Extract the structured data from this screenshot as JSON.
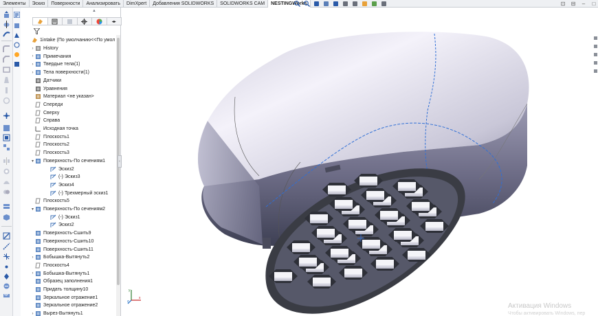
{
  "toolbar_tabs": [
    {
      "label": "Элементы"
    },
    {
      "label": "Эскиз"
    },
    {
      "label": "Поверхности"
    },
    {
      "label": "Анализировать"
    },
    {
      "label": "DimXpert"
    },
    {
      "label": "Добавления SOLIDWORKS"
    },
    {
      "label": "SOLIDWORKS CAM"
    },
    {
      "label": "NESTINGWorks"
    }
  ],
  "active_tab": "NESTINGWorks",
  "view_toolbar_icons": [
    "zoom-to-fit-icon",
    "zoom-area-icon",
    "previous-view-icon",
    "section-view-icon",
    "view-orientation-icon",
    "display-style-icon",
    "hide-show-icon",
    "appearance-icon",
    "scene-icon",
    "display-settings-icon"
  ],
  "window_controls": [
    "pin-icon",
    "restore-icon",
    "minimize-icon",
    "maximize-icon"
  ],
  "feature_tree": {
    "root_label": "1intake  (По умолчанию<<По умол",
    "items": [
      {
        "label": "History",
        "icon": "history-icon",
        "expander": true
      },
      {
        "label": "Примечания",
        "icon": "annotations-icon",
        "expander": true
      },
      {
        "label": "Твердые тела(1)",
        "icon": "solid-bodies-icon",
        "expander": true
      },
      {
        "label": "Тела поверхности(1)",
        "icon": "surface-bodies-icon",
        "expander": true
      },
      {
        "label": "Датчики",
        "icon": "sensors-icon",
        "expander": false
      },
      {
        "label": "Уравнения",
        "icon": "equations-icon",
        "expander": false
      },
      {
        "label": "Материал <не указан>",
        "icon": "material-icon",
        "expander": false
      },
      {
        "label": "Спереди",
        "icon": "plane-icon",
        "expander": false
      },
      {
        "label": "Сверху",
        "icon": "plane-icon",
        "expander": false
      },
      {
        "label": "Справа",
        "icon": "plane-icon",
        "expander": false
      },
      {
        "label": "Исходная точка",
        "icon": "origin-icon",
        "expander": false
      },
      {
        "label": "Плоскость1",
        "icon": "plane-icon",
        "expander": false
      },
      {
        "label": "Плоскость2",
        "icon": "plane-icon",
        "expander": false
      },
      {
        "label": "Плоскость3",
        "icon": "plane-icon",
        "expander": false
      },
      {
        "label": "Поверхность-По сечениям1",
        "icon": "loft-surface-icon",
        "expander": true,
        "expanded": true
      },
      {
        "label": "Эскиз2",
        "icon": "sketch-icon",
        "indent": 1
      },
      {
        "label": "(-) Эскиз3",
        "icon": "sketch-icon",
        "indent": 1
      },
      {
        "label": "Эскиз4",
        "icon": "sketch-icon",
        "indent": 1
      },
      {
        "label": "(-) Трехмерный эскиз1",
        "icon": "sketch-3d-icon",
        "indent": 1
      },
      {
        "label": "Плоскость5",
        "icon": "plane-icon",
        "expander": false
      },
      {
        "label": "Поверхность-По сечениям2",
        "icon": "loft-surface-icon",
        "expander": true,
        "expanded": true
      },
      {
        "label": "(-) Эскиз1",
        "icon": "sketch-icon",
        "indent": 1
      },
      {
        "label": "Эскиз2",
        "icon": "sketch-icon",
        "indent": 1
      },
      {
        "label": "Поверхность-Сшить9",
        "icon": "knit-surface-icon",
        "expander": false
      },
      {
        "label": "Поверхность-Сшить10",
        "icon": "knit-surface-icon",
        "expander": false
      },
      {
        "label": "Поверхность-Сшить11",
        "icon": "knit-surface-icon",
        "expander": false
      },
      {
        "label": "Бобышка-Вытянуть2",
        "icon": "extrude-boss-icon",
        "expander": true
      },
      {
        "label": "Плоскость4",
        "icon": "plane-icon",
        "expander": false
      },
      {
        "label": "Бобышка-Вытянуть1",
        "icon": "extrude-boss-icon",
        "expander": true
      },
      {
        "label": "Образец заполнения1",
        "icon": "fill-pattern-icon",
        "expander": false
      },
      {
        "label": "Придать толщину10",
        "icon": "thicken-icon",
        "expander": false
      },
      {
        "label": "Зеркальное отражение1",
        "icon": "mirror-icon",
        "expander": false
      },
      {
        "label": "Зеркальное отражение2",
        "icon": "mirror-icon",
        "expander": false
      },
      {
        "label": "Вырез-Вытянуть1",
        "icon": "extrude-cut-icon",
        "expander": true
      }
    ]
  },
  "activation_watermark": {
    "title": "Активация Windows",
    "subtitle": "Чтобы активировать Windows, пер"
  },
  "colors": {
    "selection_blue": "#2f6fd6",
    "shell_light": "#eceaf4",
    "shell_dark": "#3e4054",
    "honeycomb_frame": "#3a3c44"
  }
}
